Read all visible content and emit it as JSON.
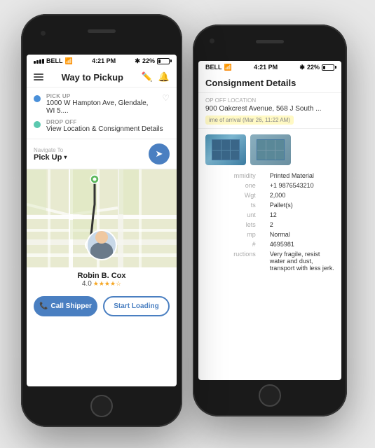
{
  "front_phone": {
    "status_bar": {
      "carrier": "BELL",
      "time": "4:21 PM",
      "battery": "22%",
      "wifi": true
    },
    "header": {
      "title": "Way to Pickup",
      "menu_label": "Menu",
      "edit_label": "Edit",
      "bell_label": "Notifications"
    },
    "pickup": {
      "label": "PICK UP",
      "address": "1000 W Hampton Ave, Glendale, WI 5...."
    },
    "dropoff": {
      "label": "DROP OFF",
      "address": "View Location & Consignment Details"
    },
    "navigate": {
      "label": "Navigate To",
      "value": "Pick Up"
    },
    "driver": {
      "name": "Robin B. Cox",
      "rating": "4.0"
    },
    "buttons": {
      "call": "Call Shipper",
      "loading": "Start Loading"
    }
  },
  "back_phone": {
    "status_bar": {
      "carrier": "BELL",
      "time": "4:21 PM",
      "battery": "22%"
    },
    "header": {
      "title": "Consignment Details"
    },
    "drop_off_location": {
      "label": "op Off Location",
      "address": "900 Oakcrest Avenue, 568 J South ...",
      "arrival": "ime of arrival (Mar 26, 11:22 AM)"
    },
    "details": [
      {
        "label": "mmidity",
        "value": "Printed Material"
      },
      {
        "label": "one",
        "value": "+1 9876543210"
      },
      {
        "label": "Wgt",
        "value": "2,000"
      },
      {
        "label": "ts",
        "value": "Pallet(s)"
      },
      {
        "label": "unt",
        "value": "12"
      },
      {
        "label": "lets",
        "value": "2"
      },
      {
        "label": "mp",
        "value": "Normal"
      },
      {
        "label": "#",
        "value": "4695981"
      },
      {
        "label": "ructions",
        "value": "Very fragile, resist water and dust, transport with less jerk."
      }
    ]
  }
}
